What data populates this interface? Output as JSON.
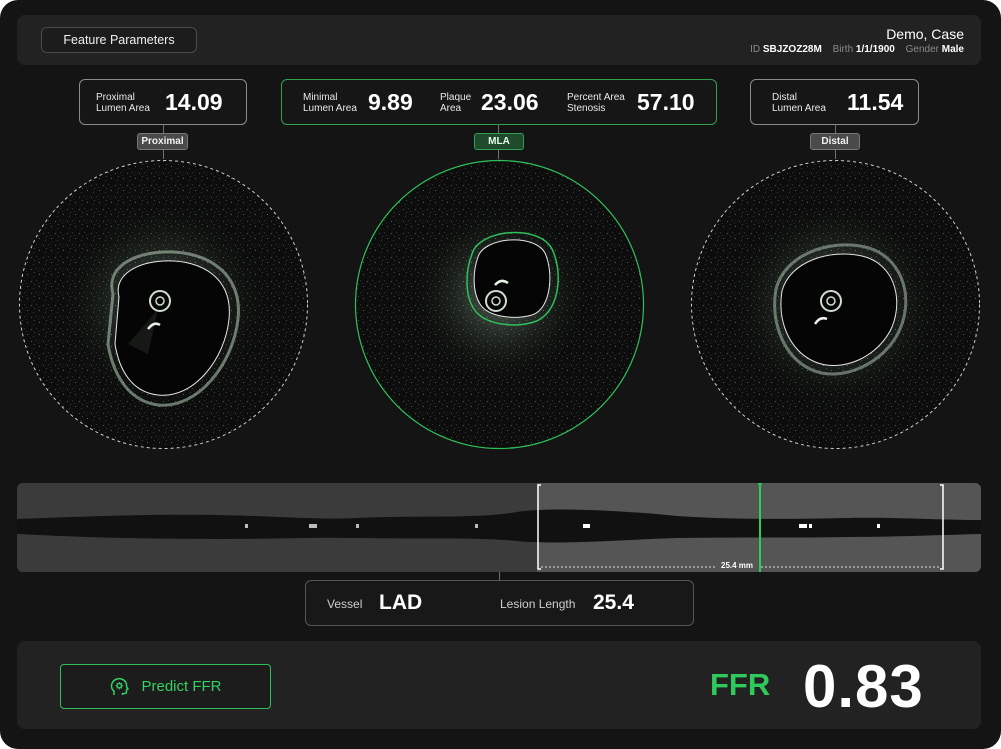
{
  "header": {
    "feature_button": "Feature Parameters",
    "patient_name": "Demo, Case",
    "id_label": "ID",
    "id_value": "SBJZOZ28M",
    "birth_label": "Birth",
    "birth_value": "1/1/1900",
    "gender_label": "Gender",
    "gender_value": "Male"
  },
  "proximal": {
    "label": "Proximal\nLumen Area",
    "value": "14.09",
    "tag": "Proximal"
  },
  "mla": {
    "min_label": "Minimal\nLumen Area",
    "min_value": "9.89",
    "plaque_label": "Plaque\nArea",
    "plaque_value": "23.06",
    "stenosis_label": "Percent Area\nStenosis",
    "stenosis_value": "57.10",
    "tag": "MLA"
  },
  "distal": {
    "label": "Distal\nLumen Area",
    "value": "11.54",
    "tag": "Distal"
  },
  "longitudinal": {
    "lesion_measure": "25.4 mm",
    "marker_fraction": 0.77
  },
  "vessel_panel": {
    "vessel_label": "Vessel",
    "vessel_value": "LAD",
    "lesion_label": "Lesion Length",
    "lesion_value": "25.4"
  },
  "bottom": {
    "predict_button": "Predict FFR",
    "ffr_label": "FFR",
    "ffr_value": "0.83"
  },
  "colors": {
    "accent_green": "#2ecb5c",
    "background": "#141414",
    "panel": "#222222"
  }
}
